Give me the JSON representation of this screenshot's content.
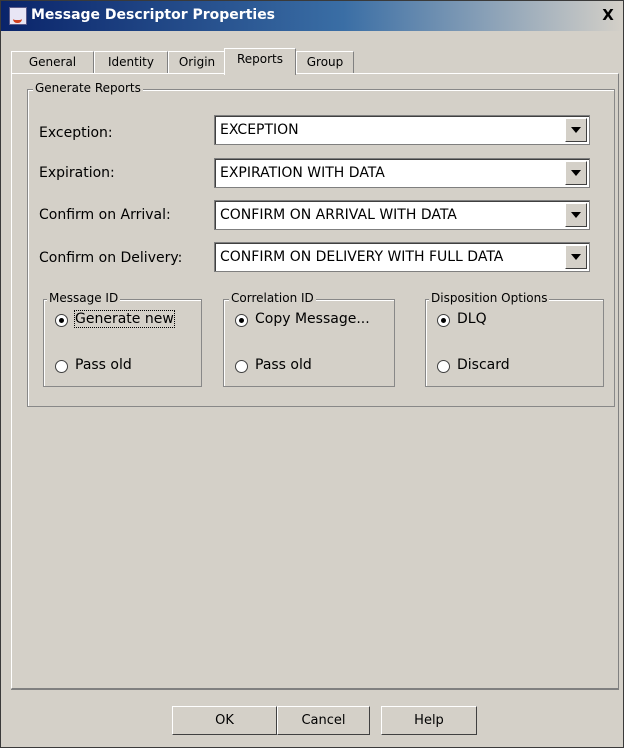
{
  "window": {
    "title": "Message Descriptor Properties",
    "close_glyph": "X"
  },
  "tabs": [
    {
      "label": "General"
    },
    {
      "label": "Identity"
    },
    {
      "label": "Origin"
    },
    {
      "label": "Reports",
      "active": true
    },
    {
      "label": "Group"
    }
  ],
  "generate_reports": {
    "legend": "Generate Reports",
    "fields": [
      {
        "label": "Exception:",
        "value": "EXCEPTION"
      },
      {
        "label": "Expiration:",
        "value": "EXPIRATION WITH DATA"
      },
      {
        "label": "Confirm on Arrival:",
        "value": "CONFIRM ON ARRIVAL WITH DATA"
      },
      {
        "label": "Confirm on Delivery:",
        "value": "CONFIRM ON DELIVERY WITH FULL DATA"
      }
    ]
  },
  "message_id": {
    "legend": "Message ID",
    "options": [
      {
        "label": "Generate new",
        "selected": true
      },
      {
        "label": "Pass old",
        "selected": false
      }
    ]
  },
  "correlation_id": {
    "legend": "Correlation ID",
    "options": [
      {
        "label": "Copy Message...",
        "selected": true
      },
      {
        "label": "Pass old",
        "selected": false
      }
    ]
  },
  "disposition": {
    "legend": "Disposition Options",
    "options": [
      {
        "label": "DLQ",
        "selected": true
      },
      {
        "label": "Discard",
        "selected": false
      }
    ]
  },
  "buttons": {
    "ok": "OK",
    "cancel": "Cancel",
    "help": "Help"
  }
}
